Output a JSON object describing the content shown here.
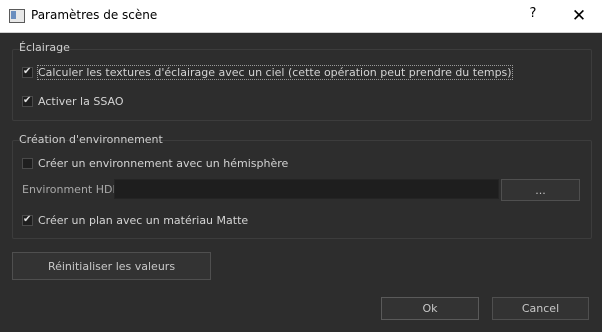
{
  "window": {
    "title": "Paramètres de scène",
    "help_glyph": "?",
    "close_glyph": "✕"
  },
  "lighting": {
    "legend": "Éclairage",
    "sky_textures": {
      "label": "Calculer les textures d'éclairage avec un ciel (cette opération peut prendre du temps)",
      "checked": true
    },
    "ssao": {
      "label": "Activer la SSAO",
      "checked": true
    }
  },
  "environment": {
    "legend": "Création d'environnement",
    "hemisphere": {
      "label": "Créer un environnement avec un hémisphère",
      "checked": false
    },
    "hdri": {
      "label": "Environment HDRI",
      "value": "",
      "browse_label": "..."
    },
    "matte_plane": {
      "label": "Créer un plan avec un matériau Matte",
      "checked": true
    }
  },
  "buttons": {
    "reset": "Réinitialiser les valeurs",
    "ok": "Ok",
    "cancel": "Cancel"
  },
  "icons": {
    "app": "window-app-icon",
    "checkmark": "checkmark-icon"
  }
}
